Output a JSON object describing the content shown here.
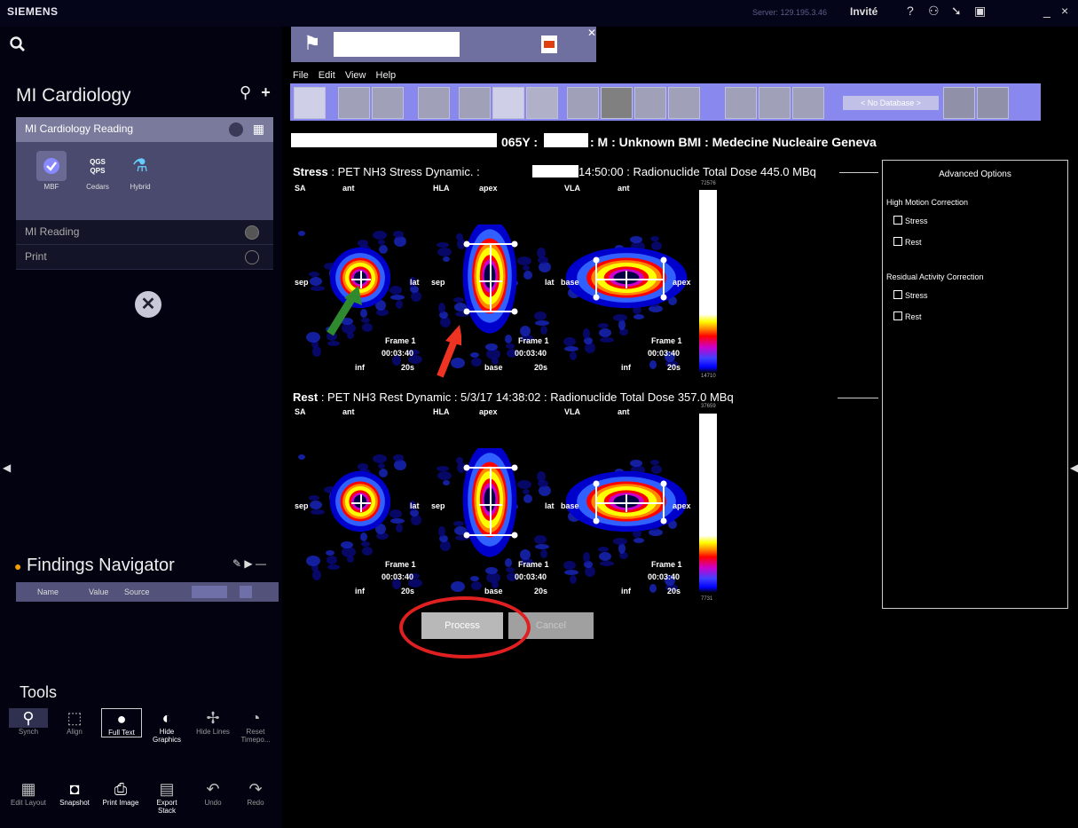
{
  "topbar": {
    "brand": "SIEMENS",
    "server": "Server: 129.195.3.46",
    "user": "Invité",
    "help_glyph": "?",
    "minimize_glyph": "_",
    "close_glyph": "×"
  },
  "sidebar": {
    "section_title": "MI Cardiology",
    "add_glyph": "+",
    "reading_header": "MI Cardiology Reading",
    "workflows": [
      {
        "label": "MBF",
        "icon": "check-icon"
      },
      {
        "label": "Cedars",
        "icon": "qgs-qps-icon",
        "badge": "QGS QPS"
      },
      {
        "label": "Hybrid",
        "icon": "hybrid-icon"
      }
    ],
    "menu": [
      "MI Reading",
      "Print"
    ],
    "close_glyph": "✕"
  },
  "findings": {
    "title": "Findings Navigator",
    "columns": [
      "Name",
      "Value",
      "Source"
    ]
  },
  "tools": {
    "title": "Tools",
    "row1": [
      {
        "label": "Synch",
        "glyph": "⚲"
      },
      {
        "label": "Align",
        "glyph": "⬚"
      },
      {
        "label": "Full Text",
        "glyph": "●"
      },
      {
        "label": "Hide Graphics",
        "glyph": "◐"
      },
      {
        "label": "Hide Lines",
        "glyph": "✢"
      },
      {
        "label": "Reset Timepo...",
        "glyph": "◔"
      }
    ],
    "row2": [
      {
        "label": "Edit Layout",
        "glyph": "▦"
      },
      {
        "label": "Snapshot",
        "glyph": "◘"
      },
      {
        "label": "Print Image",
        "glyph": "⎙"
      },
      {
        "label": "Export Stack",
        "glyph": "▤"
      },
      {
        "label": "Undo",
        "glyph": "↶"
      },
      {
        "label": "Redo",
        "glyph": "↷"
      }
    ]
  },
  "menubar": [
    "File",
    "Edit",
    "View",
    "Help"
  ],
  "toolbar": {
    "database": "< No Database >"
  },
  "patient": {
    "age": "065Y :",
    "info": ": M : Unknown BMI : Medecine Nucleaire Geneva"
  },
  "stress": {
    "type": "Stress",
    "desc_before": ": PET  NH3  Stress  Dynamic. :",
    "desc_after": "14:50:00 : Radionuclide Total Dose 445.0 MBq",
    "scale_max": "72576",
    "scale_min": "14710"
  },
  "rest": {
    "type": "Rest",
    "desc": ": PET  NH3  Rest  Dynamic : 5/3/17 14:38:02 : Radionuclide Total Dose 357.0 MBq",
    "scale_max": "37659",
    "scale_min": "7731"
  },
  "view_labels": {
    "sa": "SA",
    "ant": "ant",
    "hla": "HLA",
    "apex": "apex",
    "vla": "VLA",
    "sep": "sep",
    "lat": "lat",
    "base": "base",
    "inf": "inf",
    "frame": "Frame 1",
    "time": "00:03:40",
    "dur": "20s"
  },
  "advanced": {
    "title": "Advanced Options",
    "motion_title": "High Motion Correction",
    "residual_title": "Residual Activity Correction",
    "stress": "Stress",
    "rest": "Rest"
  },
  "actions": {
    "process": "Process",
    "cancel": "Cancel"
  },
  "colors": {
    "toolbar": "#8888ee",
    "panel": "#4a4a6e",
    "highlight_ring": "#e02020",
    "green_arrow": "#2f8a2f",
    "red_arrow": "#ee3322"
  }
}
